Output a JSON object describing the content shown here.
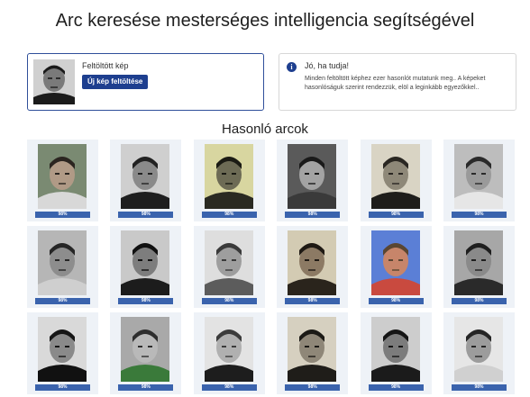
{
  "page": {
    "title": "Arc keresése mesterséges intelligencia segítségével"
  },
  "upload": {
    "label": "Feltöltött kép",
    "button": "Új kép feltöltése"
  },
  "info": {
    "title": "Jó, ha tudja!",
    "text": "Minden feltöltött képhez ezer hasonlót mutatunk meg.. A képeket hasonlóságuk szerint rendezzük, elöl a leginkább egyezőkkel.."
  },
  "results": {
    "heading": "Hasonló arcok",
    "items": [
      {
        "match": "98%",
        "bg": "#7a8a72",
        "skin": "#b09a86",
        "hair": "#2b2520",
        "shirt": "#d8d8d8"
      },
      {
        "match": "98%",
        "bg": "#cfcfcf",
        "skin": "#8a8a8a",
        "hair": "#222222",
        "shirt": "#1e1e1e"
      },
      {
        "match": "98%",
        "bg": "#d8d6a0",
        "skin": "#6d6b55",
        "hair": "#1b1b14",
        "shirt": "#2a2a22"
      },
      {
        "match": "98%",
        "bg": "#5a5a5a",
        "skin": "#a3a3a3",
        "hair": "#1a1a1a",
        "shirt": "#3a3a3a"
      },
      {
        "match": "98%",
        "bg": "#d9d4c4",
        "skin": "#8e8878",
        "hair": "#2a2722",
        "shirt": "#1e1d1a"
      },
      {
        "match": "98%",
        "bg": "#bdbdbd",
        "skin": "#9a9a9a",
        "hair": "#2a2a2a",
        "shirt": "#e6e6e6"
      },
      {
        "match": "98%",
        "bg": "#b6b6b6",
        "skin": "#8d8d8d",
        "hair": "#262626",
        "shirt": "#cfcfcf"
      },
      {
        "match": "98%",
        "bg": "#c9c9c9",
        "skin": "#7d7d7d",
        "hair": "#111111",
        "shirt": "#1c1c1c"
      },
      {
        "match": "98%",
        "bg": "#dedede",
        "skin": "#9e9e9e",
        "hair": "#3a3a3a",
        "shirt": "#5c5c5c"
      },
      {
        "match": "98%",
        "bg": "#d3cbb3",
        "skin": "#8c7a64",
        "hair": "#1f1a14",
        "shirt": "#2a241c"
      },
      {
        "match": "98%",
        "bg": "#5b7fd6",
        "skin": "#c7856a",
        "hair": "#5a4632",
        "shirt": "#c94a3f"
      },
      {
        "match": "98%",
        "bg": "#a7a7a7",
        "skin": "#8a8a8a",
        "hair": "#1f1f1f",
        "shirt": "#2a2a2a"
      },
      {
        "match": "98%",
        "bg": "#d9d9d9",
        "skin": "#8a8a8a",
        "hair": "#161616",
        "shirt": "#111111"
      },
      {
        "match": "98%",
        "bg": "#a9a9a9",
        "skin": "#b9b9b9",
        "hair": "#2e2e2e",
        "shirt": "#3a7a3a"
      },
      {
        "match": "98%",
        "bg": "#e3e3e3",
        "skin": "#b0b0b0",
        "hair": "#3c3c3c",
        "shirt": "#1d1d1d"
      },
      {
        "match": "98%",
        "bg": "#d6d0c0",
        "skin": "#8f8778",
        "hair": "#1c1a16",
        "shirt": "#1f1d19"
      },
      {
        "match": "98%",
        "bg": "#cdcdcd",
        "skin": "#7c7c7c",
        "hair": "#151515",
        "shirt": "#1b1b1b"
      },
      {
        "match": "98%",
        "bg": "#e6e6e6",
        "skin": "#9c9c9c",
        "hair": "#262626",
        "shirt": "#d0d0d0"
      }
    ]
  }
}
